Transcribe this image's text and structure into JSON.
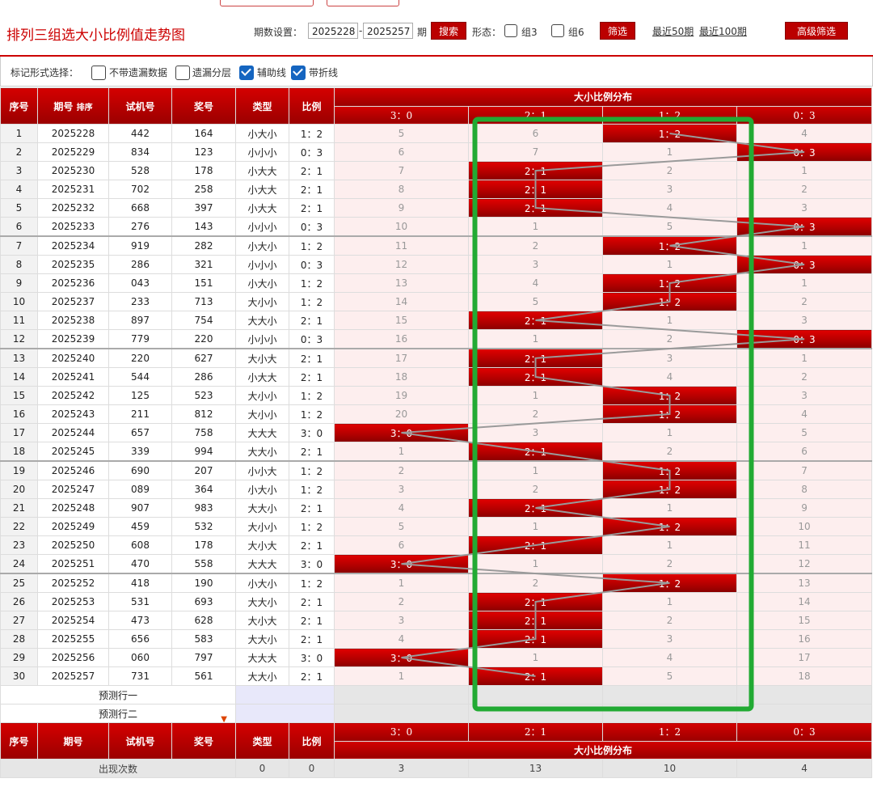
{
  "header": {
    "title": "排列三组选大小比例值走势图",
    "period_label": "期数设置：",
    "period_from": "2025228",
    "period_dash": "-",
    "period_to": "2025257",
    "period_unit": "期",
    "search_btn": "搜索",
    "form_label": "形态：",
    "group3": "组3",
    "group6": "组6",
    "filter_btn": "筛选",
    "recent50": "最近50期",
    "recent100": "最近100期",
    "advanced_btn": "高级筛选"
  },
  "marks": {
    "label": "标记形式选择：",
    "opt1": "不带遗漏数据",
    "opt2": "遗漏分层",
    "opt3": "辅助线",
    "opt4": "带折线",
    "opt3_checked": true,
    "opt4_checked": true
  },
  "table": {
    "headers": {
      "idx": "序号",
      "period": "期号",
      "sort": "排序",
      "trial": "试机号",
      "prize": "奖号",
      "type": "类型",
      "ratio": "比例",
      "dist": "大小比例分布"
    },
    "ratio_cols": [
      "3：0",
      "2：1",
      "1：2",
      "0：3"
    ],
    "rows": [
      {
        "i": "1",
        "p": "2025228",
        "t": "442",
        "n": "164",
        "ty": "小大小",
        "r": "1：2",
        "c": [
          "5",
          "6",
          "1：2",
          "4"
        ]
      },
      {
        "i": "2",
        "p": "2025229",
        "t": "834",
        "n": "123",
        "ty": "小小小",
        "r": "0：3",
        "c": [
          "6",
          "7",
          "1",
          "0：3"
        ]
      },
      {
        "i": "3",
        "p": "2025230",
        "t": "528",
        "n": "178",
        "ty": "小大大",
        "r": "2：1",
        "c": [
          "7",
          "2：1",
          "2",
          "1"
        ]
      },
      {
        "i": "4",
        "p": "2025231",
        "t": "702",
        "n": "258",
        "ty": "小大大",
        "r": "2：1",
        "c": [
          "8",
          "2：1",
          "3",
          "2"
        ]
      },
      {
        "i": "5",
        "p": "2025232",
        "t": "668",
        "n": "397",
        "ty": "小大大",
        "r": "2：1",
        "c": [
          "9",
          "2：1",
          "4",
          "3"
        ]
      },
      {
        "i": "6",
        "p": "2025233",
        "t": "276",
        "n": "143",
        "ty": "小小小",
        "r": "0：3",
        "c": [
          "10",
          "1",
          "5",
          "0：3"
        ]
      },
      {
        "i": "7",
        "p": "2025234",
        "t": "919",
        "n": "282",
        "ty": "小大小",
        "r": "1：2",
        "c": [
          "11",
          "2",
          "1：2",
          "1"
        ]
      },
      {
        "i": "8",
        "p": "2025235",
        "t": "286",
        "n": "321",
        "ty": "小小小",
        "r": "0：3",
        "c": [
          "12",
          "3",
          "1",
          "0：3"
        ]
      },
      {
        "i": "9",
        "p": "2025236",
        "t": "043",
        "n": "151",
        "ty": "小大小",
        "r": "1：2",
        "c": [
          "13",
          "4",
          "1：2",
          "1"
        ]
      },
      {
        "i": "10",
        "p": "2025237",
        "t": "233",
        "n": "713",
        "ty": "大小小",
        "r": "1：2",
        "c": [
          "14",
          "5",
          "1：2",
          "2"
        ]
      },
      {
        "i": "11",
        "p": "2025238",
        "t": "897",
        "n": "754",
        "ty": "大大小",
        "r": "2：1",
        "c": [
          "15",
          "2：1",
          "1",
          "3"
        ]
      },
      {
        "i": "12",
        "p": "2025239",
        "t": "779",
        "n": "220",
        "ty": "小小小",
        "r": "0：3",
        "c": [
          "16",
          "1",
          "2",
          "0：3"
        ]
      },
      {
        "i": "13",
        "p": "2025240",
        "t": "220",
        "n": "627",
        "ty": "大小大",
        "r": "2：1",
        "c": [
          "17",
          "2：1",
          "3",
          "1"
        ]
      },
      {
        "i": "14",
        "p": "2025241",
        "t": "544",
        "n": "286",
        "ty": "小大大",
        "r": "2：1",
        "c": [
          "18",
          "2：1",
          "4",
          "2"
        ]
      },
      {
        "i": "15",
        "p": "2025242",
        "t": "125",
        "n": "523",
        "ty": "大小小",
        "r": "1：2",
        "c": [
          "19",
          "1",
          "1：2",
          "3"
        ]
      },
      {
        "i": "16",
        "p": "2025243",
        "t": "211",
        "n": "812",
        "ty": "大小小",
        "r": "1：2",
        "c": [
          "20",
          "2",
          "1：2",
          "4"
        ]
      },
      {
        "i": "17",
        "p": "2025244",
        "t": "657",
        "n": "758",
        "ty": "大大大",
        "r": "3：0",
        "c": [
          "3：0",
          "3",
          "1",
          "5"
        ]
      },
      {
        "i": "18",
        "p": "2025245",
        "t": "339",
        "n": "994",
        "ty": "大大小",
        "r": "2：1",
        "c": [
          "1",
          "2：1",
          "2",
          "6"
        ]
      },
      {
        "i": "19",
        "p": "2025246",
        "t": "690",
        "n": "207",
        "ty": "小小大",
        "r": "1：2",
        "c": [
          "2",
          "1",
          "1：2",
          "7"
        ]
      },
      {
        "i": "20",
        "p": "2025247",
        "t": "089",
        "n": "364",
        "ty": "小大小",
        "r": "1：2",
        "c": [
          "3",
          "2",
          "1：2",
          "8"
        ]
      },
      {
        "i": "21",
        "p": "2025248",
        "t": "907",
        "n": "983",
        "ty": "大大小",
        "r": "2：1",
        "c": [
          "4",
          "2：1",
          "1",
          "9"
        ]
      },
      {
        "i": "22",
        "p": "2025249",
        "t": "459",
        "n": "532",
        "ty": "大小小",
        "r": "1：2",
        "c": [
          "5",
          "1",
          "1：2",
          "10"
        ]
      },
      {
        "i": "23",
        "p": "2025250",
        "t": "608",
        "n": "178",
        "ty": "大小大",
        "r": "2：1",
        "c": [
          "6",
          "2：1",
          "1",
          "11"
        ]
      },
      {
        "i": "24",
        "p": "2025251",
        "t": "470",
        "n": "558",
        "ty": "大大大",
        "r": "3：0",
        "c": [
          "3：0",
          "1",
          "2",
          "12"
        ]
      },
      {
        "i": "25",
        "p": "2025252",
        "t": "418",
        "n": "190",
        "ty": "小大小",
        "r": "1：2",
        "c": [
          "1",
          "2",
          "1：2",
          "13"
        ]
      },
      {
        "i": "26",
        "p": "2025253",
        "t": "531",
        "n": "693",
        "ty": "大大小",
        "r": "2：1",
        "c": [
          "2",
          "2：1",
          "1",
          "14"
        ]
      },
      {
        "i": "27",
        "p": "2025254",
        "t": "473",
        "n": "628",
        "ty": "大小大",
        "r": "2：1",
        "c": [
          "3",
          "2：1",
          "2",
          "15"
        ]
      },
      {
        "i": "28",
        "p": "2025255",
        "t": "656",
        "n": "583",
        "ty": "大大小",
        "r": "2：1",
        "c": [
          "4",
          "2：1",
          "3",
          "16"
        ]
      },
      {
        "i": "29",
        "p": "2025256",
        "t": "060",
        "n": "797",
        "ty": "大大大",
        "r": "3：0",
        "c": [
          "3：0",
          "1",
          "4",
          "17"
        ]
      },
      {
        "i": "30",
        "p": "2025257",
        "t": "731",
        "n": "561",
        "ty": "大大小",
        "r": "2：1",
        "c": [
          "1",
          "2：1",
          "5",
          "18"
        ]
      }
    ],
    "pred1": "预测行一",
    "pred2": "预测行二",
    "footer_label": "出现次数",
    "footer_type": "0",
    "footer_ratio": "0",
    "footer_counts": [
      "3",
      "13",
      "10",
      "4"
    ]
  },
  "colors": {
    "accent": "#c00000",
    "highlight": "#22aa33"
  }
}
